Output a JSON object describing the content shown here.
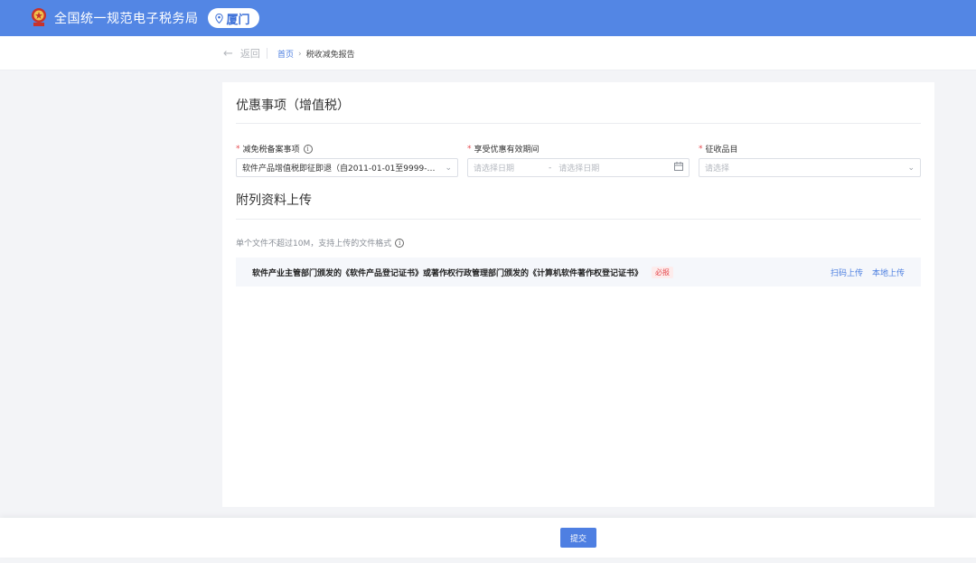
{
  "header": {
    "brand": "全国统一规范电子税务局",
    "city": "厦门"
  },
  "breadcrumb": {
    "back_label": "返回",
    "home": "首页",
    "separator": "›",
    "current": "税收减免报告"
  },
  "section_preferential": {
    "title": "优惠事项（增值税）",
    "fields": {
      "filing_item": {
        "required_mark": "*",
        "label": "减免税备案事项",
        "value": "软件产品增值税即征即退（自2011-01-01至9999-…"
      },
      "valid_period": {
        "required_mark": "*",
        "label": "享受优惠有效期间",
        "start_placeholder": "请选择日期",
        "separator": "-",
        "end_placeholder": "请选择日期"
      },
      "levy_item": {
        "required_mark": "*",
        "label": "征收品目",
        "placeholder": "请选择"
      }
    }
  },
  "section_attachments": {
    "title": "附列资料上传",
    "hint": "单个文件不超过10M，支持上传的文件格式",
    "rows": [
      {
        "text": "软件产业主管部门颁发的《软件产品登记证书》或著作权行政管理部门颁发的《计算机软件著作权登记证书》",
        "badge": "必报",
        "actions": [
          "扫码上传",
          "本地上传"
        ]
      }
    ]
  },
  "footer": {
    "submit_label": "提交"
  },
  "colors": {
    "topbar": "#5386e4",
    "primary": "#4e7fe2",
    "required": "#e5484d"
  }
}
